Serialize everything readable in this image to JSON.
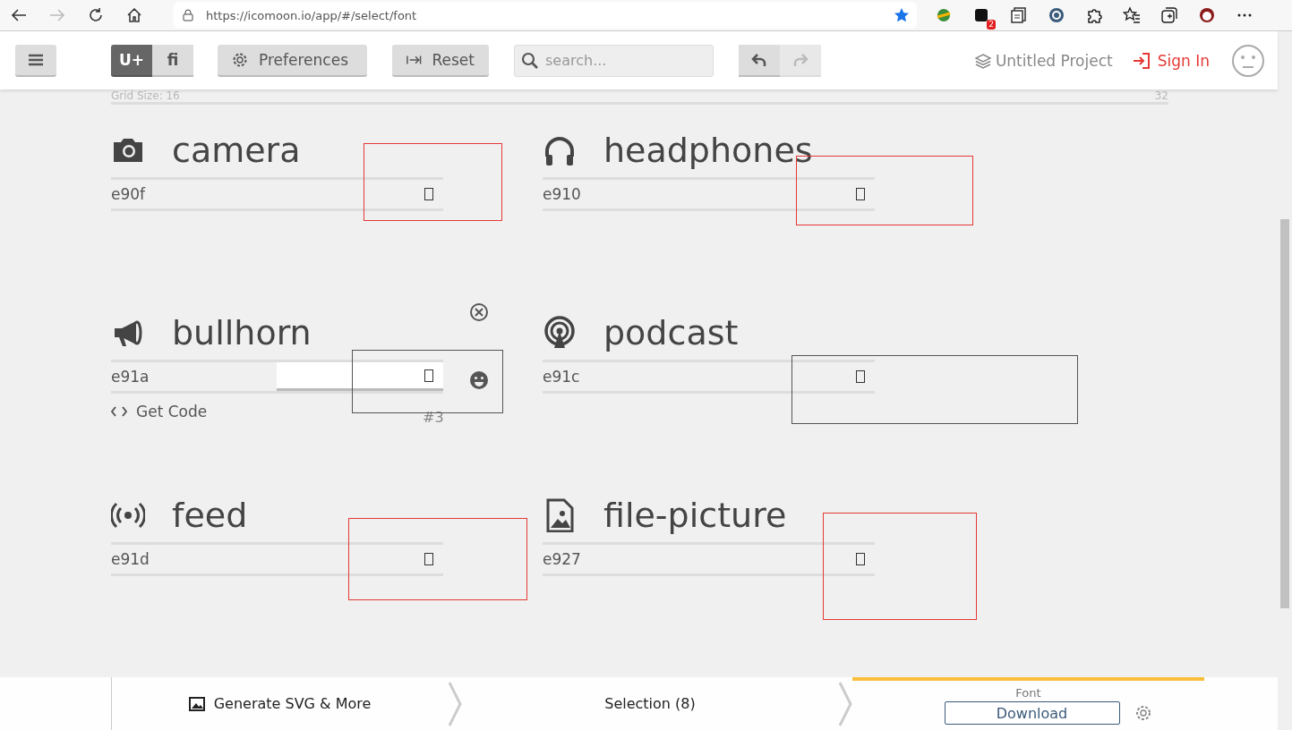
{
  "browser": {
    "url": "https://icomoon.io/app/#/select/font",
    "forward_disabled": true,
    "bookmarked": true,
    "extension_badge": "2"
  },
  "toolbar": {
    "mode_tabs": [
      {
        "label": "U+",
        "selected": true
      },
      {
        "label": "fi",
        "selected": false
      }
    ],
    "preferences": "Preferences",
    "reset": "Reset",
    "search": {
      "placeholder": "search..."
    },
    "history": [
      {
        "kind": "undo",
        "disabled": false
      },
      {
        "kind": "redo",
        "disabled": true
      }
    ],
    "project": "Untitled Project",
    "sign_in": "Sign In"
  },
  "grid": {
    "label": "Grid Size: 16",
    "value": "32"
  },
  "glyphs": [
    {
      "kind": "camera",
      "name": "camera",
      "code": "e90f",
      "selected": false,
      "annotation": {
        "color": "#e53935"
      }
    },
    {
      "kind": "headphones",
      "name": "headphones",
      "code": "e910",
      "selected": false,
      "annotation": {
        "color": "#e53935"
      }
    },
    {
      "kind": "bullhorn",
      "name": "bullhorn",
      "code": "e91a",
      "selected": true,
      "get_code": "Get Code",
      "number": "#3",
      "annotation": {
        "color": "#555555"
      }
    },
    {
      "kind": "podcast",
      "name": "podcast",
      "code": "e91c",
      "selected": false,
      "annotation": {
        "color": "#555555"
      }
    },
    {
      "kind": "feed",
      "name": "feed",
      "code": "e91d",
      "selected": false,
      "annotation": {
        "color": "#e53935"
      }
    },
    {
      "kind": "picture",
      "name": "file-picture",
      "code": "e927",
      "selected": false,
      "annotation": {
        "color": "#e53935"
      }
    }
  ],
  "bottom_bar": {
    "tabs": [
      {
        "kind": "generate",
        "label": "Generate SVG & More",
        "selected": false
      },
      {
        "kind": "selection",
        "label": "Selection (8)",
        "selected": false
      },
      {
        "kind": "font",
        "label": "Font",
        "button": "Download",
        "selected": true
      }
    ]
  }
}
